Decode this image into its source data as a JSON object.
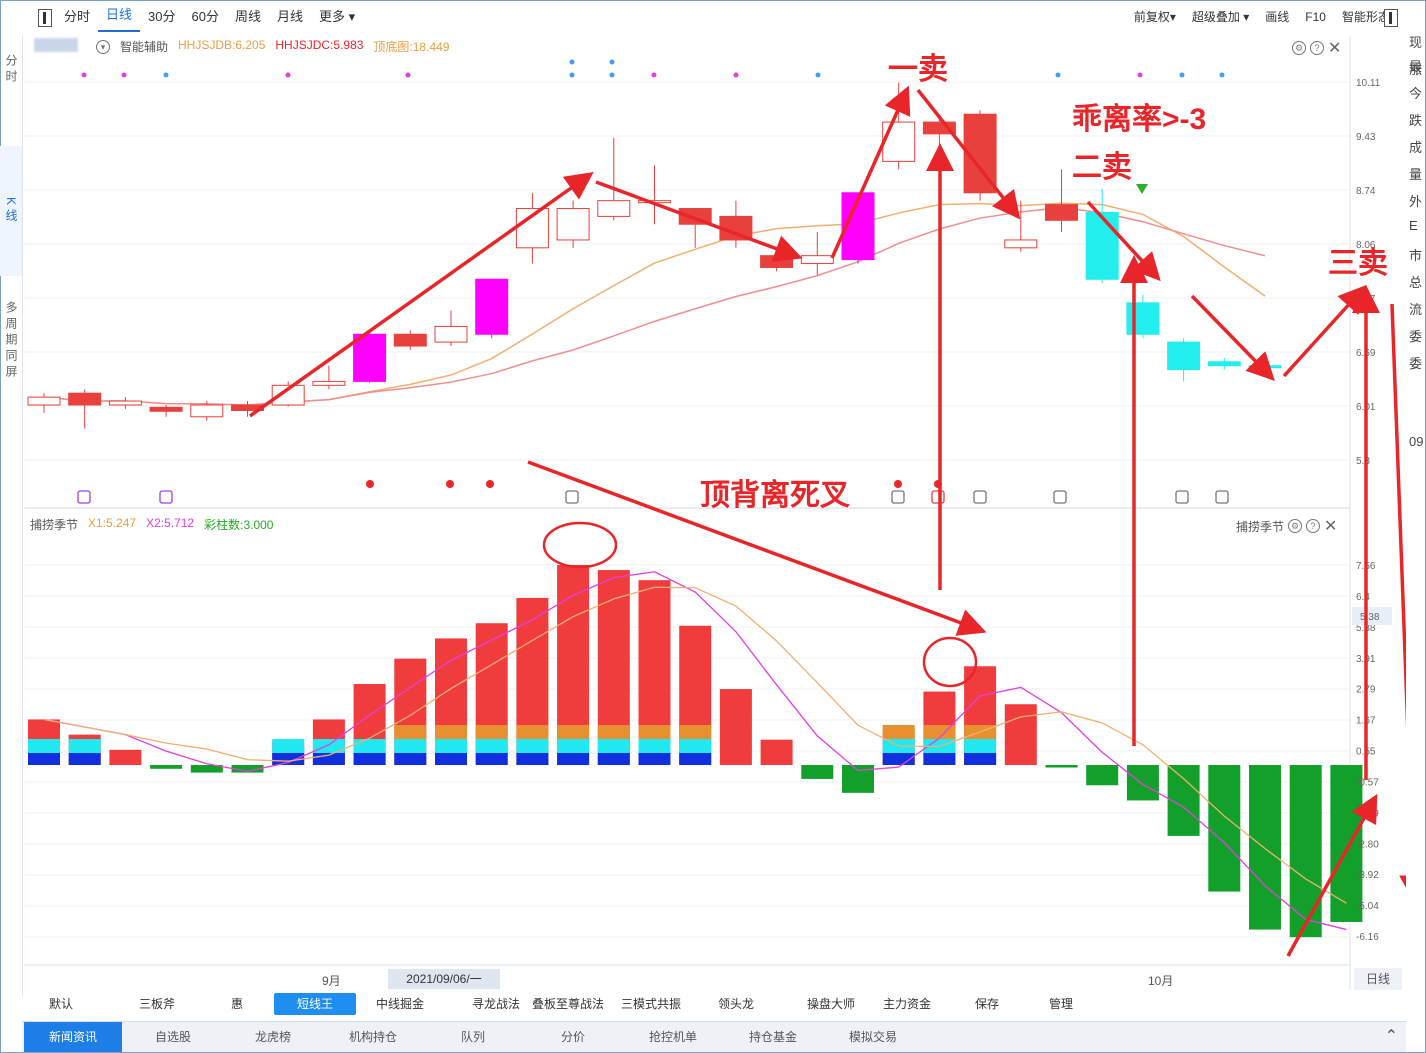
{
  "toolbar": {
    "left_items": [
      "分时",
      "日线",
      "30分",
      "60分",
      "周线",
      "月线",
      "更多 ▾"
    ],
    "active": "日线",
    "right_items": [
      "前复权▾",
      "超级叠加 ▾",
      "画线",
      "F10",
      "智能形态"
    ]
  },
  "left_tabs": [
    "分时",
    "K线",
    "多周期同屏"
  ],
  "right_side_chars": [
    "现",
    "涨",
    "最",
    "今",
    "跌",
    "成",
    "量",
    "外",
    "E",
    "市",
    "总",
    "流",
    "委",
    "委",
    "09"
  ],
  "kline_panel": {
    "assistant_label": "智能辅助",
    "indicators": [
      {
        "text": "HHJSJDB:6.205",
        "color": "#e8a040"
      },
      {
        "text": "HHJSJDC:5.983",
        "color": "#e8262a"
      },
      {
        "text": "顶底图:18.449",
        "color": "#e8a040"
      }
    ],
    "price_axis": [
      "10.11",
      "9.43",
      "8.74",
      "8.06",
      "7.37",
      "6.69",
      "6.01",
      "5.3"
    ],
    "price_range": [
      5.3,
      10.11
    ]
  },
  "macd_panel": {
    "name": "捕捞季节",
    "indicators": [
      {
        "text": "X1:5.247",
        "color": "#e8a040"
      },
      {
        "text": "X2:5.712",
        "color": "#e040e0"
      },
      {
        "text": "彩柱数:3.000",
        "color": "#22aa22"
      }
    ],
    "right_name": "捕捞季节",
    "axis": [
      "7.56",
      "6.4",
      "5.38",
      "3.91",
      "2.79",
      "1.67",
      "0.55",
      "-0.57",
      "-1.69",
      "-2.80",
      "-3.92",
      "-5.04",
      "-6.16"
    ],
    "current_tag": "5.38"
  },
  "date_axis": {
    "labels": [
      "9月",
      "2021/09/06/一",
      "10月"
    ],
    "period_label": "日线"
  },
  "chart_data": {
    "type": "candlestick+histogram",
    "candles": [
      {
        "o": 6.0,
        "c": 6.1,
        "h": 6.15,
        "l": 5.9
      },
      {
        "o": 6.15,
        "c": 6.0,
        "h": 6.2,
        "l": 5.7
      },
      {
        "o": 6.0,
        "c": 6.05,
        "h": 6.1,
        "l": 5.95
      },
      {
        "o": 5.97,
        "c": 5.92,
        "h": 6.0,
        "l": 5.85
      },
      {
        "o": 5.85,
        "c": 6.0,
        "h": 6.05,
        "l": 5.8
      },
      {
        "o": 6.0,
        "c": 5.93,
        "h": 6.05,
        "l": 5.85
      },
      {
        "o": 6.0,
        "c": 6.25,
        "h": 6.3,
        "l": 5.98
      },
      {
        "o": 6.25,
        "c": 6.3,
        "h": 6.5,
        "l": 6.2
      },
      {
        "o": 6.3,
        "c": 6.9,
        "h": 6.95,
        "l": 6.28
      },
      {
        "o": 6.9,
        "c": 6.75,
        "h": 6.95,
        "l": 6.7
      },
      {
        "o": 6.8,
        "c": 7.0,
        "h": 7.2,
        "l": 6.75
      },
      {
        "o": 6.9,
        "c": 7.6,
        "h": 7.6,
        "l": 6.85
      },
      {
        "o": 8.0,
        "c": 8.5,
        "h": 8.7,
        "l": 7.8
      },
      {
        "o": 8.1,
        "c": 8.5,
        "h": 8.6,
        "l": 8.0
      },
      {
        "o": 8.4,
        "c": 8.6,
        "h": 9.4,
        "l": 8.35
      },
      {
        "o": 8.6,
        "c": 8.6,
        "h": 9.05,
        "l": 8.3
      },
      {
        "o": 8.5,
        "c": 8.3,
        "h": 8.5,
        "l": 8.0
      },
      {
        "o": 8.4,
        "c": 8.1,
        "h": 8.6,
        "l": 8.0
      },
      {
        "o": 7.9,
        "c": 7.75,
        "h": 8.0,
        "l": 7.7
      },
      {
        "o": 7.8,
        "c": 7.9,
        "h": 8.2,
        "l": 7.65
      },
      {
        "o": 7.85,
        "c": 8.7,
        "h": 8.7,
        "l": 7.8
      },
      {
        "o": 9.1,
        "c": 9.6,
        "h": 10.1,
        "l": 9.0
      },
      {
        "o": 9.6,
        "c": 9.45,
        "h": 9.7,
        "l": 9.2
      },
      {
        "o": 9.7,
        "c": 8.7,
        "h": 9.75,
        "l": 8.6
      },
      {
        "o": 8.0,
        "c": 8.1,
        "h": 8.6,
        "l": 7.95
      },
      {
        "o": 8.55,
        "c": 8.35,
        "h": 9.0,
        "l": 8.2
      },
      {
        "o": 8.45,
        "c": 7.6,
        "h": 8.75,
        "l": 7.55
      },
      {
        "o": 7.3,
        "c": 6.9,
        "h": 7.4,
        "l": 6.85
      },
      {
        "o": 6.8,
        "c": 6.45,
        "h": 6.85,
        "l": 6.3
      },
      {
        "o": 6.55,
        "c": 6.5,
        "h": 6.6,
        "l": 6.45
      },
      {
        "o": 6.5,
        "c": 6.48,
        "h": 6.55,
        "l": 6.45
      }
    ],
    "candle_colors": [
      "up",
      "down",
      "up",
      "down",
      "up",
      "down",
      "up",
      "up",
      "magenta",
      "down",
      "up",
      "magenta",
      "up",
      "up",
      "up",
      "up",
      "down",
      "down",
      "down",
      "up",
      "magenta",
      "up",
      "down",
      "down",
      "up",
      "down",
      "cyan",
      "cyan",
      "cyan",
      "cyan",
      "cyan"
    ],
    "histogram": [
      1.8,
      1.2,
      0.6,
      -0.15,
      -0.3,
      -0.3,
      0.9,
      1.8,
      3.2,
      4.2,
      5.0,
      5.6,
      6.6,
      7.9,
      7.7,
      7.3,
      5.5,
      3.0,
      1.0,
      -0.55,
      -1.1,
      1.4,
      2.9,
      3.9,
      2.4,
      -0.1,
      -0.8,
      -1.4,
      -2.8,
      -5.0,
      -6.5,
      -6.8,
      -6.2
    ],
    "title": "",
    "xlabel": "",
    "ylabel": ""
  },
  "annotations": {
    "sell1": "一卖",
    "deviation": "乖离率>-3",
    "sell2": "二卖",
    "sell3": "三卖",
    "divergence": "顶背离死叉"
  },
  "bottom_tabs": [
    "默认",
    "三板斧",
    "惠",
    "短线王",
    "中线掘金",
    "寻龙战法",
    "叠板至尊战法",
    "三模式共振",
    "领头龙",
    "操盘大师",
    "主力资金",
    "保存",
    "管理"
  ],
  "bottom_active": "短线王",
  "footer_tabs": [
    "新闻资讯",
    "自选股",
    "龙虎榜",
    "机构持仓",
    "队列",
    "分价",
    "抢控机单",
    "持仓基金",
    "模拟交易"
  ],
  "footer_active": "新闻资讯",
  "colors": {
    "up": "#e8403c",
    "down_fill": "#e8403c",
    "magenta": "#ff00ff",
    "cyan": "#22eeee",
    "green": "#12a02a",
    "accent": "#1e6fd9"
  }
}
